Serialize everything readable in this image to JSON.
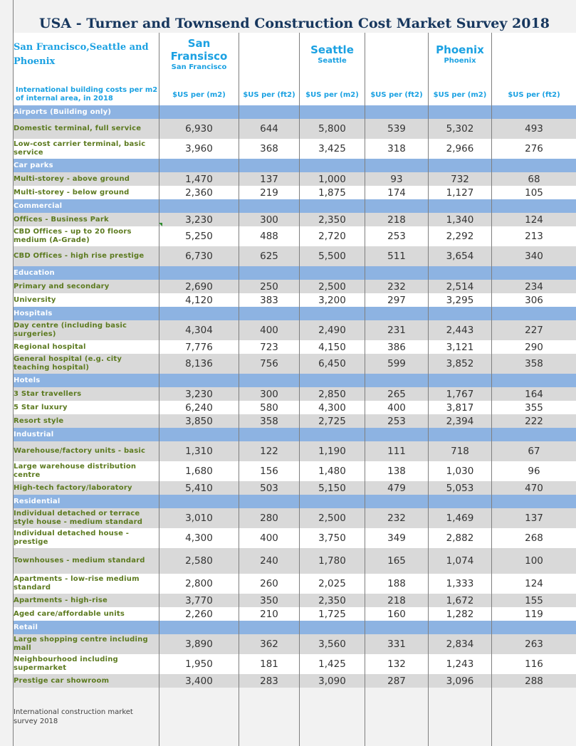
{
  "title": "USA - Turner and Townsend Construction Cost Market Survey 2018",
  "region_label": "San Francisco,Seattle and Phoenix",
  "cities": [
    {
      "name": "San Fransisco",
      "sub": "San Francisco"
    },
    {
      "name": "Seattle",
      "sub": "Seattle"
    },
    {
      "name": "Phoenix",
      "sub": "Phoenix"
    }
  ],
  "units_intro": "International building costs per m2 of internal area, in 2018",
  "units": [
    "$US per (m2)",
    "$US per (ft2)",
    "$US per (m2)",
    "$US per (ft2)",
    "$US per (m2)",
    "$US per (ft2)"
  ],
  "footer_note": "International construction market survey 2018",
  "colors": {
    "header_blue": "#1ba1e2",
    "title_navy": "#17375e",
    "category_band": "#8db3e2",
    "label_green": "#5c7a1f",
    "stripe_gray": "#d9d9d9"
  },
  "chart_data": {
    "type": "table",
    "title": "USA - Turner and Townsend Construction Cost Market Survey 2018",
    "columns": [
      "San Fransisco $US per (m2)",
      "San Fransisco $US per (ft2)",
      "Seattle $US per (m2)",
      "Seattle $US per (ft2)",
      "Phoenix $US per (m2)",
      "Phoenix $US per (ft2)"
    ],
    "rows": [
      {
        "kind": "cat",
        "label": "Airports (Building only)"
      },
      {
        "kind": "item",
        "label": "Domestic terminal, full service",
        "values": [
          "6,930",
          "644",
          "5,800",
          "539",
          "5,302",
          "493"
        ]
      },
      {
        "kind": "item",
        "label": "Low-cost carrier terminal, basic service",
        "values": [
          "3,960",
          "368",
          "3,425",
          "318",
          "2,966",
          "276"
        ]
      },
      {
        "kind": "cat",
        "label": "Car parks"
      },
      {
        "kind": "item",
        "label": "Multi-storey - above ground",
        "values": [
          "1,470",
          "137",
          "1,000",
          "93",
          "732",
          "68"
        ]
      },
      {
        "kind": "item",
        "label": "Multi-storey - below ground",
        "values": [
          "2,360",
          "219",
          "1,875",
          "174",
          "1,127",
          "105"
        ]
      },
      {
        "kind": "cat",
        "label": "Commercial"
      },
      {
        "kind": "item",
        "label": "Offices - Business Park",
        "values": [
          "3,230",
          "300",
          "2,350",
          "218",
          "1,340",
          "124"
        ]
      },
      {
        "kind": "item",
        "label": "CBD Offices - up to 20 floors medium (A-Grade)",
        "values": [
          "5,250",
          "488",
          "2,720",
          "253",
          "2,292",
          "213"
        ]
      },
      {
        "kind": "item",
        "label": "CBD Offices - high rise prestige",
        "values": [
          "6,730",
          "625",
          "5,500",
          "511",
          "3,654",
          "340"
        ]
      },
      {
        "kind": "cat",
        "label": "Education"
      },
      {
        "kind": "item",
        "label": "Primary and secondary",
        "values": [
          "2,690",
          "250",
          "2,500",
          "232",
          "2,514",
          "234"
        ]
      },
      {
        "kind": "item",
        "label": "University",
        "values": [
          "4,120",
          "383",
          "3,200",
          "297",
          "3,295",
          "306"
        ]
      },
      {
        "kind": "cat",
        "label": "Hospitals"
      },
      {
        "kind": "item",
        "label": "Day centre (including basic surgeries)",
        "values": [
          "4,304",
          "400",
          "2,490",
          "231",
          "2,443",
          "227"
        ]
      },
      {
        "kind": "item",
        "label": "Regional hospital",
        "values": [
          "7,776",
          "723",
          "4,150",
          "386",
          "3,121",
          "290"
        ]
      },
      {
        "kind": "item",
        "label": "General hospital (e.g. city teaching hospital)",
        "values": [
          "8,136",
          "756",
          "6,450",
          "599",
          "3,852",
          "358"
        ]
      },
      {
        "kind": "cat",
        "label": "Hotels"
      },
      {
        "kind": "item",
        "label": "3 Star travellers",
        "values": [
          "3,230",
          "300",
          "2,850",
          "265",
          "1,767",
          "164"
        ]
      },
      {
        "kind": "item",
        "label": "5 Star luxury",
        "values": [
          "6,240",
          "580",
          "4,300",
          "400",
          "3,817",
          "355"
        ]
      },
      {
        "kind": "item",
        "label": "Resort style",
        "values": [
          "3,850",
          "358",
          "2,725",
          "253",
          "2,394",
          "222"
        ]
      },
      {
        "kind": "cat",
        "label": "Industrial"
      },
      {
        "kind": "item",
        "label": "Warehouse/factory units - basic",
        "values": [
          "1,310",
          "122",
          "1,190",
          "111",
          "718",
          "67"
        ]
      },
      {
        "kind": "item",
        "label": "Large warehouse distribution centre",
        "values": [
          "1,680",
          "156",
          "1,480",
          "138",
          "1,030",
          "96"
        ]
      },
      {
        "kind": "item",
        "label": "High-tech factory/laboratory",
        "values": [
          "5,410",
          "503",
          "5,150",
          "479",
          "5,053",
          "470"
        ]
      },
      {
        "kind": "cat",
        "label": "Residential"
      },
      {
        "kind": "item",
        "label": "Individual detached or terrace style house - medium standard",
        "values": [
          "3,010",
          "280",
          "2,500",
          "232",
          "1,469",
          "137"
        ]
      },
      {
        "kind": "item",
        "label": "Individual detached house - prestige",
        "values": [
          "4,300",
          "400",
          "3,750",
          "349",
          "2,882",
          "268"
        ]
      },
      {
        "kind": "item",
        "label": "Townhouses - medium standard",
        "values": [
          "2,580",
          "240",
          "1,780",
          "165",
          "1,074",
          "100"
        ]
      },
      {
        "kind": "item",
        "label": "Apartments - low-rise medium standard",
        "values": [
          "2,800",
          "260",
          "2,025",
          "188",
          "1,333",
          "124"
        ]
      },
      {
        "kind": "item",
        "label": "Apartments - high-rise",
        "values": [
          "3,770",
          "350",
          "2,350",
          "218",
          "1,672",
          "155"
        ]
      },
      {
        "kind": "item",
        "label": "Aged care/affordable units",
        "values": [
          "2,260",
          "210",
          "1,725",
          "160",
          "1,282",
          "119"
        ]
      },
      {
        "kind": "cat",
        "label": "Retail"
      },
      {
        "kind": "item",
        "label": "Large shopping centre including mall",
        "values": [
          "3,890",
          "362",
          "3,560",
          "331",
          "2,834",
          "263"
        ]
      },
      {
        "kind": "item",
        "label": "Neighbourhood including supermarket",
        "values": [
          "1,950",
          "181",
          "1,425",
          "132",
          "1,243",
          "116"
        ]
      },
      {
        "kind": "item",
        "label": "Prestige car showroom",
        "values": [
          "3,400",
          "283",
          "3,090",
          "287",
          "3,096",
          "288"
        ]
      }
    ]
  }
}
